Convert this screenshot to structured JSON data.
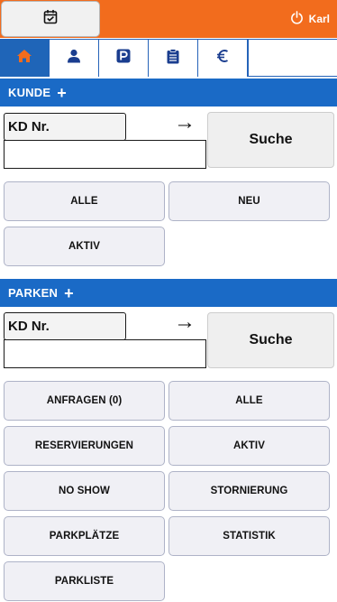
{
  "topbar": {
    "calendar_icon": "calendar-check-icon",
    "power_icon": "power-icon",
    "user_name": "Karl",
    "accent_color": "#f26c1d"
  },
  "tabs": [
    {
      "icon": "home-icon",
      "active": true
    },
    {
      "icon": "user-icon",
      "active": false
    },
    {
      "icon": "parking-icon",
      "active": false
    },
    {
      "icon": "clipboard-list-icon",
      "active": false
    },
    {
      "icon": "euro-icon",
      "active": false
    }
  ],
  "kunde": {
    "title": "KUNDE",
    "plus": "+",
    "field_label": "KD Nr.",
    "arrow": "→",
    "search_label": "Suche",
    "buttons": {
      "alle": "ALLE",
      "neu": "NEU",
      "aktiv": "AKTIV"
    }
  },
  "parken": {
    "title": "PARKEN",
    "plus": "+",
    "field_label": "KD Nr.",
    "arrow": "→",
    "search_label": "Suche",
    "buttons": {
      "anfragen": "ANFRAGEN (0)",
      "alle": "ALLE",
      "reservierungen": "RESERVIERUNGEN",
      "aktiv": "AKTIV",
      "no_show": "NO SHOW",
      "stornierung": "STORNIERUNG",
      "parkplaetze": "PARKPLÄTZE",
      "statistik": "STATISTIK",
      "parkliste": "PARKLISTE"
    }
  },
  "colors": {
    "section_header": "#1a6ac6",
    "tab_active": "#1f65b8"
  }
}
